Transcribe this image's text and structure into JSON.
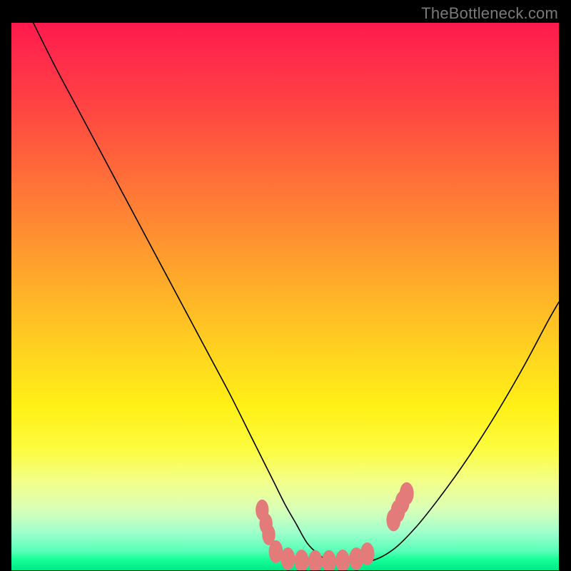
{
  "attribution": "TheBottleneck.com",
  "chart_data": {
    "type": "line",
    "title": "",
    "xlabel": "",
    "ylabel": "",
    "xlim": [
      0,
      100
    ],
    "ylim": [
      0,
      100
    ],
    "grid": false,
    "series": [
      {
        "name": "bottleneck-curve",
        "color": "#000000",
        "x": [
          4,
          8,
          12,
          16,
          20,
          24,
          28,
          32,
          36,
          40,
          44,
          46,
          48,
          50,
          52,
          54,
          56,
          58,
          62,
          66,
          70,
          74,
          78,
          82,
          86,
          90,
          94,
          98,
          100
        ],
        "y": [
          100,
          92,
          84.5,
          77,
          69.5,
          62,
          54.5,
          47,
          39.5,
          32,
          24,
          20,
          16,
          12,
          8.5,
          5,
          3,
          1.8,
          1.5,
          1.8,
          4,
          8,
          13,
          18.5,
          24.5,
          31,
          38,
          45.5,
          49
        ]
      }
    ],
    "markers": [
      {
        "name": "highlight-dots",
        "color": "#e47b7b",
        "shape": "round",
        "points": [
          {
            "x": 45.8,
            "y": 11.0,
            "r": 1.2
          },
          {
            "x": 46.5,
            "y": 8.5,
            "r": 1.2
          },
          {
            "x": 47.0,
            "y": 6.5,
            "r": 1.2
          },
          {
            "x": 48.3,
            "y": 3.4,
            "r": 1.3
          },
          {
            "x": 50.5,
            "y": 2.1,
            "r": 1.3
          },
          {
            "x": 53.0,
            "y": 1.7,
            "r": 1.3
          },
          {
            "x": 55.5,
            "y": 1.6,
            "r": 1.3
          },
          {
            "x": 58.0,
            "y": 1.6,
            "r": 1.3
          },
          {
            "x": 60.5,
            "y": 1.7,
            "r": 1.3
          },
          {
            "x": 63.0,
            "y": 2.1,
            "r": 1.3
          },
          {
            "x": 65.0,
            "y": 3.0,
            "r": 1.3
          },
          {
            "x": 69.8,
            "y": 9.2,
            "r": 1.3
          },
          {
            "x": 70.6,
            "y": 10.8,
            "r": 1.3
          },
          {
            "x": 71.4,
            "y": 12.4,
            "r": 1.3
          },
          {
            "x": 72.2,
            "y": 14.0,
            "r": 1.3
          }
        ]
      }
    ]
  }
}
